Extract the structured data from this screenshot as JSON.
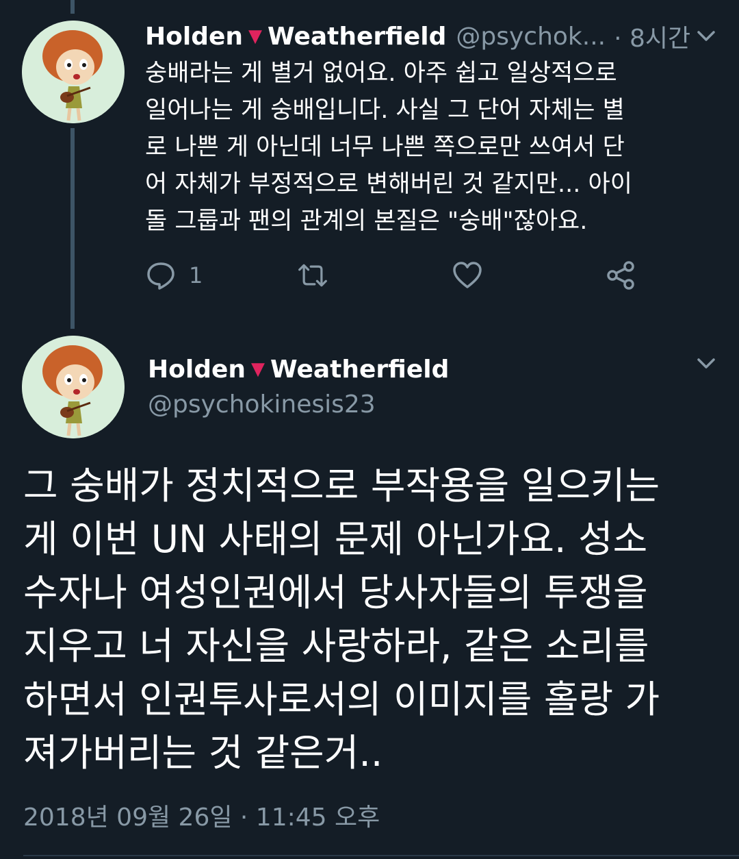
{
  "colors": {
    "background": "#141d26",
    "text_primary": "#ffffff",
    "text_secondary": "#8899a6",
    "accent_heart": "#e0245e",
    "thread_line": "#3d5466"
  },
  "tweet_reply": {
    "author_name_first": "Holden",
    "author_name_last": "Weatherfield",
    "name_glyph": "▼",
    "handle": "@psychok...",
    "time": "· 8시간",
    "text": "숭배라는 게 별거 없어요. 아주 쉽고 일상적으로\n일어나는 게 숭배입니다. 사실 그 단어 자체는 별\n로 나쁜 게 아닌데 너무 나쁜 쪽으로만 쓰여서 단\n어 자체가 부정적으로 변해버린 것 같지만... 아이\n돌 그룹과 팬의 관계의 본질은 \"숭배\"잖아요.",
    "reply_count": "1",
    "icons": {
      "reply": "reply-icon",
      "retweet": "retweet-icon",
      "like": "like-icon",
      "share": "share-icon",
      "menu": "chevron-down-icon"
    }
  },
  "tweet_main": {
    "author_name_first": "Holden",
    "author_name_last": "Weatherfield",
    "name_glyph": "▼",
    "handle": "@psychokinesis23",
    "text": "그 숭배가 정치적으로 부작용을 일으키는\n게 이번 UN 사태의 문제 아닌가요. 성소\n수자나 여성인권에서 당사자들의 투쟁을\n지우고 너 자신을 사랑하라, 같은 소리를\n하면서 인권투사로서의 이미지를 홀랑 가\n져가버리는 것 같은거..",
    "timestamp": "2018년 09월 26일 · 11:45 오후"
  }
}
